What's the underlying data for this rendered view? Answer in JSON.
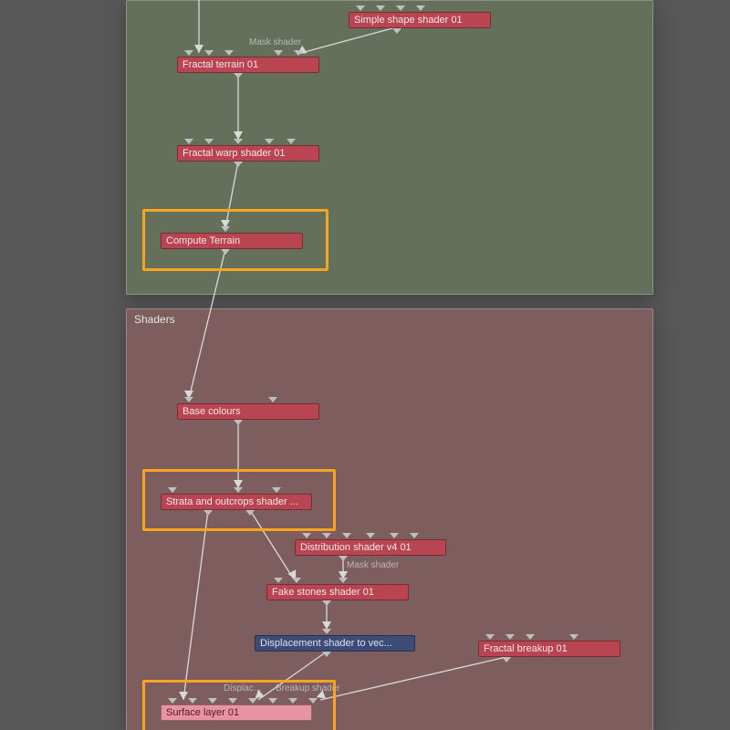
{
  "groups": {
    "terrain": {
      "title": ""
    },
    "shaders": {
      "title": "Shaders"
    }
  },
  "nodes": {
    "simple_shape": {
      "label": "Simple shape shader 01"
    },
    "mask_shader1": {
      "label": "Mask shader"
    },
    "fractal_terr": {
      "label": "Fractal terrain 01"
    },
    "fractal_warp": {
      "label": "Fractal warp shader 01"
    },
    "compute_terr": {
      "label": "Compute Terrain"
    },
    "base_colours": {
      "label": "Base colours"
    },
    "strata": {
      "label": "Strata and outcrops shader ..."
    },
    "dist_v4": {
      "label": "Distribution shader v4 01"
    },
    "mask_shader2": {
      "label": "Mask shader"
    },
    "fake_stones": {
      "label": "Fake stones shader 01"
    },
    "disp_to_vec": {
      "label": "Displacement shader to vec..."
    },
    "fract_breakup": {
      "label": "Fractal breakup 01"
    },
    "displac": {
      "label": "Displac..."
    },
    "breakup_sh": {
      "label": "Breakup shader"
    },
    "surface_layer": {
      "label": "Surface layer 01"
    }
  }
}
